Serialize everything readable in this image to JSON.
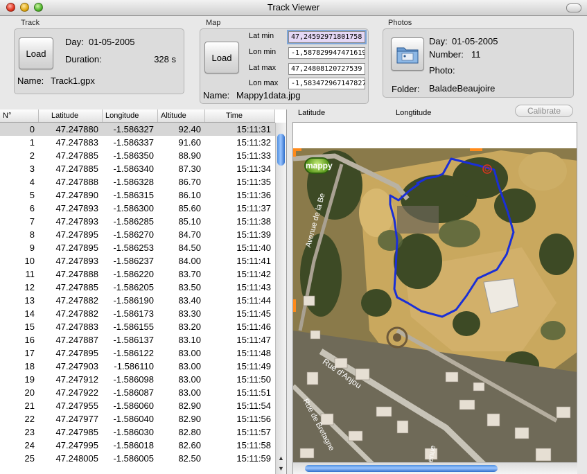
{
  "window": {
    "title": "Track Viewer"
  },
  "track": {
    "section": "Track",
    "load_label": "Load",
    "day_label": "Day:",
    "day_value": "01-05-2005",
    "duration_label": "Duration:",
    "duration_value": "328 s",
    "name_label": "Name:",
    "name_value": "Track1.gpx"
  },
  "map": {
    "section": "Map",
    "load_label": "Load",
    "lat_min_label": "Lat min",
    "lat_min_value": "47,24592971801758",
    "lon_min_label": "Lon min",
    "lon_min_value": "-1,587829947471619",
    "lat_max_label": "Lat max",
    "lat_max_value": "47,24808120727539",
    "lon_max_label": "Lon max",
    "lon_max_value": "-1,583472967147827",
    "name_label": "Name:",
    "name_value": "Mappy1data.jpg"
  },
  "photos": {
    "section": "Photos",
    "folder_icon": "folder-icon",
    "day_label": "Day:",
    "day_value": "01-05-2005",
    "number_label": "Number:",
    "number_value": "11",
    "photo_label": "Photo:",
    "folder_label": "Folder:",
    "folder_value": "BaladeBeaujoire"
  },
  "table": {
    "headers": [
      "N°",
      "Latitude",
      "Longitude",
      "Altitude",
      "Time"
    ],
    "rows": [
      [
        "0",
        "47.247880",
        "-1.586327",
        "92.40",
        "15:11:31"
      ],
      [
        "1",
        "47.247883",
        "-1.586337",
        "91.60",
        "15:11:32"
      ],
      [
        "2",
        "47.247885",
        "-1.586350",
        "88.90",
        "15:11:33"
      ],
      [
        "3",
        "47.247885",
        "-1.586340",
        "87.30",
        "15:11:34"
      ],
      [
        "4",
        "47.247888",
        "-1.586328",
        "86.70",
        "15:11:35"
      ],
      [
        "5",
        "47.247890",
        "-1.586315",
        "86.10",
        "15:11:36"
      ],
      [
        "6",
        "47.247893",
        "-1.586300",
        "85.60",
        "15:11:37"
      ],
      [
        "7",
        "47.247893",
        "-1.586285",
        "85.10",
        "15:11:38"
      ],
      [
        "8",
        "47.247895",
        "-1.586270",
        "84.70",
        "15:11:39"
      ],
      [
        "9",
        "47.247895",
        "-1.586253",
        "84.50",
        "15:11:40"
      ],
      [
        "10",
        "47.247893",
        "-1.586237",
        "84.00",
        "15:11:41"
      ],
      [
        "11",
        "47.247888",
        "-1.586220",
        "83.70",
        "15:11:42"
      ],
      [
        "12",
        "47.247885",
        "-1.586205",
        "83.50",
        "15:11:43"
      ],
      [
        "13",
        "47.247882",
        "-1.586190",
        "83.40",
        "15:11:44"
      ],
      [
        "14",
        "47.247882",
        "-1.586173",
        "83.30",
        "15:11:45"
      ],
      [
        "15",
        "47.247883",
        "-1.586155",
        "83.20",
        "15:11:46"
      ],
      [
        "16",
        "47.247887",
        "-1.586137",
        "83.10",
        "15:11:47"
      ],
      [
        "17",
        "47.247895",
        "-1.586122",
        "83.00",
        "15:11:48"
      ],
      [
        "18",
        "47.247903",
        "-1.586110",
        "83.00",
        "15:11:49"
      ],
      [
        "19",
        "47.247912",
        "-1.586098",
        "83.00",
        "15:11:50"
      ],
      [
        "20",
        "47.247922",
        "-1.586087",
        "83.00",
        "15:11:51"
      ],
      [
        "21",
        "47.247955",
        "-1.586060",
        "82.90",
        "15:11:54"
      ],
      [
        "22",
        "47.247977",
        "-1.586040",
        "82.90",
        "15:11:56"
      ],
      [
        "23",
        "47.247985",
        "-1.586030",
        "82.80",
        "15:11:57"
      ],
      [
        "24",
        "47.247995",
        "-1.586018",
        "82.60",
        "15:11:58"
      ],
      [
        "25",
        "47.248005",
        "-1.586005",
        "82.50",
        "15:11:59"
      ]
    ],
    "selected_row": 0
  },
  "map_view": {
    "latitude_label": "Latitude",
    "longitude_label": "Longtitude",
    "calibrate_label": "Calibrate",
    "logo_text": "mappy",
    "streets": [
      "Avenue de la Be",
      "Rue d'Anjou",
      "Rue de Bretagne",
      "enue"
    ],
    "track_color": "#1a2fd6",
    "marker_color": "#e0341f"
  }
}
